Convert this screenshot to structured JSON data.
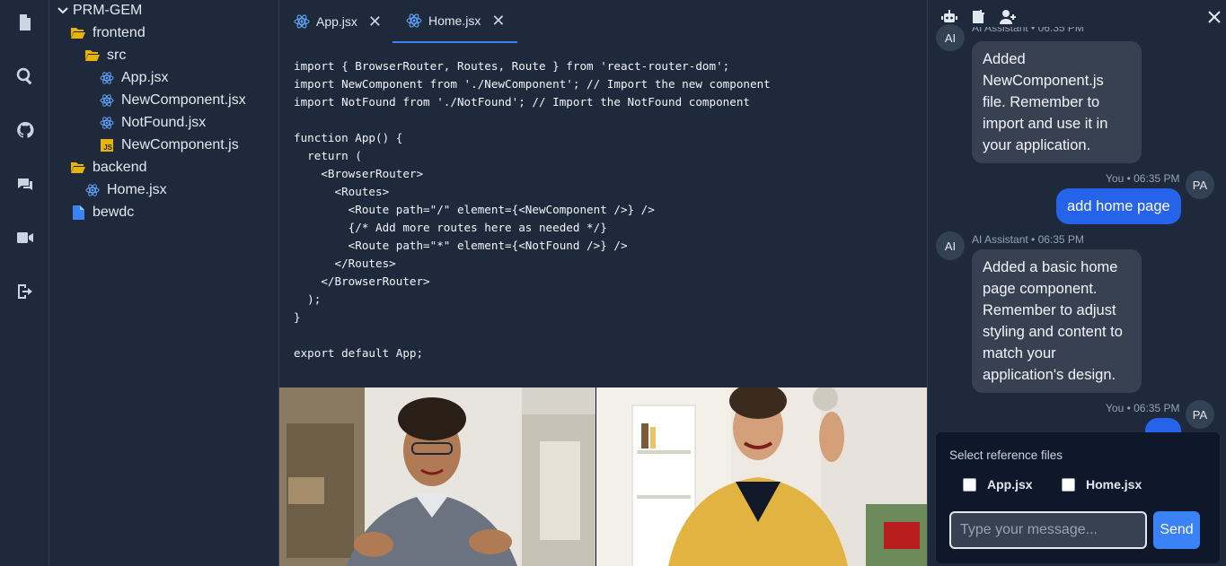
{
  "explorer": {
    "root": "PRM-GEM",
    "items": [
      {
        "label": "frontend"
      },
      {
        "label": "src"
      },
      {
        "label": "App.jsx"
      },
      {
        "label": "NewComponent.jsx"
      },
      {
        "label": "NotFound.jsx"
      },
      {
        "label": "NewComponent.js"
      },
      {
        "label": "backend"
      },
      {
        "label": "Home.jsx"
      },
      {
        "label": "bewdc"
      }
    ]
  },
  "tabs": [
    {
      "label": "App.jsx"
    },
    {
      "label": "Home.jsx"
    }
  ],
  "editor": {
    "code": "import { BrowserRouter, Routes, Route } from 'react-router-dom';\nimport NewComponent from './NewComponent'; // Import the new component\nimport NotFound from './NotFound'; // Import the NotFound component\n\nfunction App() {\n  return (\n    <BrowserRouter>\n      <Routes>\n        <Route path=\"/\" element={<NewComponent />} />\n        {/* Add more routes here as needed */}\n        <Route path=\"*\" element={<NotFound />} />\n      </Routes>\n    </BrowserRouter>\n  );\n}\n\nexport default App;"
  },
  "chat": {
    "messages": [
      {
        "meta": "AI Assistant • 06:35 PM",
        "avatar": "AI",
        "text": "Added NewComponent.js file. Remember to import and use it in your application."
      },
      {
        "meta": "You • 06:35 PM",
        "avatar": "PA",
        "text": "add home page"
      },
      {
        "meta": "AI Assistant • 06:35 PM",
        "avatar": "AI",
        "text": "Added a basic home page component. Remember to adjust styling and content to match your application's design."
      },
      {
        "meta": "You • 06:35 PM",
        "avatar": "PA",
        "text": ""
      }
    ],
    "reference_title": "Select reference files",
    "ref_files": [
      {
        "label": "App.jsx"
      },
      {
        "label": "Home.jsx"
      }
    ],
    "input_placeholder": "Type your message...",
    "send_label": "Send"
  },
  "colors": {
    "accent": "#3b82f6",
    "user_bubble": "#2563eb",
    "ai_bubble": "#374151",
    "folder": "#eab308",
    "react": "#60a5fa"
  }
}
